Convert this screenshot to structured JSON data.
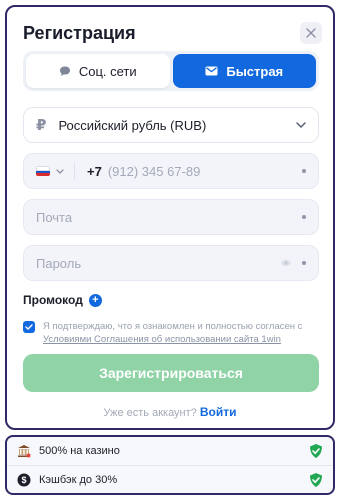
{
  "form": {
    "title": "Регистрация",
    "tabs": [
      {
        "label": "Соц. сети",
        "icon": "chat-icon"
      },
      {
        "label": "Быстрая",
        "icon": "mail-icon",
        "active": true
      }
    ],
    "currency": {
      "symbol": "₽",
      "value": "Российский рубль (RUB)"
    },
    "phone": {
      "code": "+7",
      "placeholder": "(912) 345 67-89"
    },
    "email": {
      "placeholder": "Почта"
    },
    "password": {
      "placeholder": "Пароль"
    },
    "promo_label": "Промокод",
    "agree": {
      "text": "Я подтверждаю, что я ознакомлен и полностью согласен с",
      "link": "Условиями Соглашения об использовании сайта 1win"
    },
    "submit_label": "Зарегистрироваться",
    "login_prompt": "Уже есть аккаунт?",
    "login_link": "Войти"
  },
  "bonuses": [
    {
      "icon": "casino-icon",
      "label": "500% на казино"
    },
    {
      "icon": "cashback-icon",
      "label": "Кэшбэк до 30%"
    }
  ],
  "colors": {
    "accent": "#1268de",
    "submit": "#8fd3a6",
    "border": "#2f2a66",
    "check": "#22a855"
  }
}
